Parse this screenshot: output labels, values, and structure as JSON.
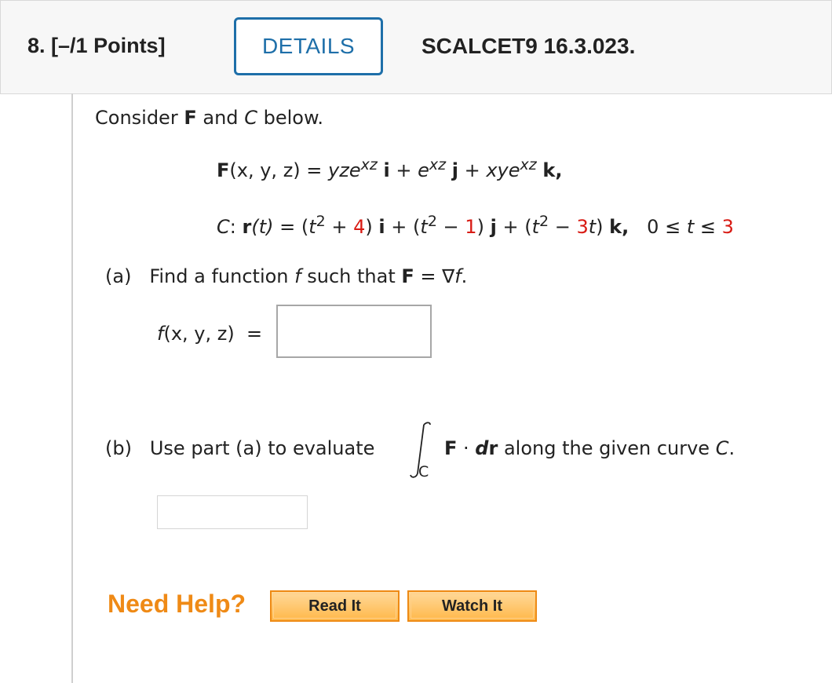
{
  "header": {
    "question_number": "8.",
    "points": "[–/1 Points]",
    "details_label": "DETAILS",
    "problem_code": "SCALCET9 16.3.023."
  },
  "prompt": {
    "consider": "Consider",
    "F": "F",
    "and": "and",
    "C": "C",
    "below": "below."
  },
  "field": {
    "lhs": "F",
    "args": "(x, y, z)",
    "eq": " = ",
    "t1": "yze",
    "t1_exp": "xz",
    "unit_i": "i",
    "plus1": " + ",
    "t2": "e",
    "t2_exp": "xz",
    "unit_j": "j",
    "plus2": " + ",
    "t3": "xye",
    "t3_exp": "xz",
    "unit_k": "k",
    "comma": ","
  },
  "curve": {
    "C": "C",
    "colon": ": ",
    "r": "r",
    "t_arg": "(t)",
    "eq": " = ",
    "part_open1": "(",
    "t1": "t",
    "exp2": "2",
    "plus4": " + ",
    "c4": "4",
    "close_i": ")",
    "unit_i": "i",
    "plus_a": " + ",
    "part_open2": "(",
    "t2": "t",
    "minus1": " − ",
    "c1": "1",
    "close_j": ")",
    "unit_j": "j",
    "plus_b": " + ",
    "part_open3": "(",
    "t3": "t",
    "minus3t": " − ",
    "c3": "3",
    "t_var": "t",
    "close_k": ")",
    "unit_k": "k",
    "comma": ",",
    "range_lo": "0",
    "range_op": " ≤ ",
    "range_t": "t",
    "range_op2": " ≤ ",
    "range_hi": "3"
  },
  "part_a": {
    "label": "(a)",
    "text": "Find a function",
    "f": "f",
    "such": "such that",
    "F": "F",
    "eq": " = ∇",
    "f2": "f",
    "period": ".",
    "answer_label_f": "f",
    "answer_label_args": "(x, y, z)",
    "answer_label_eq": "  ="
  },
  "part_b": {
    "label": "(b)",
    "text": "Use part (a) to evaluate",
    "integral_sub": "C",
    "F": "F",
    "dot": " · ",
    "dr": "d",
    "r": "r",
    "rest": "along the given curve",
    "C": "C",
    "period": "."
  },
  "help": {
    "need_help": "Need Help?",
    "read_it": "Read It",
    "watch_it": "Watch It"
  },
  "colors": {
    "accent_blue": "#1e6fa9",
    "red_values": "#d81b14",
    "help_orange": "#ef8a16"
  }
}
